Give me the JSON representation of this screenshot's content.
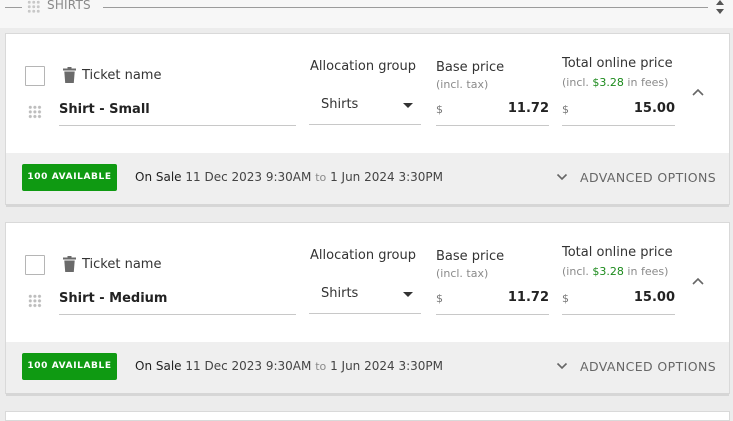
{
  "section": {
    "title": "SHIRTS"
  },
  "labels": {
    "ticket_name": "Ticket name",
    "allocation_group": "Allocation group",
    "base_price": "Base price",
    "incl_tax": "(incl. tax)",
    "total_online_price": "Total online price",
    "incl_prefix": "(incl.",
    "in_fees_suffix": "in fees)",
    "currency_symbol": "$",
    "on_sale": "On Sale",
    "to": "to",
    "advanced_options": "ADVANCED OPTIONS"
  },
  "tickets": [
    {
      "name": "Shirt - Small",
      "allocation_group": "Shirts",
      "base_price": "11.72",
      "fees": "$3.28",
      "total_price": "15.00",
      "availability": "100 AVAILABLE",
      "sale_start": "11 Dec 2023 9:30AM",
      "sale_end": "1 Jun 2024 3:30PM"
    },
    {
      "name": "Shirt - Medium",
      "allocation_group": "Shirts",
      "base_price": "11.72",
      "fees": "$3.28",
      "total_price": "15.00",
      "availability": "100 AVAILABLE",
      "sale_start": "11 Dec 2023 9:30AM",
      "sale_end": "1 Jun 2024 3:30PM"
    }
  ],
  "colors": {
    "available_badge": "#0f9a12",
    "fee_text": "#1c8a1c",
    "footer_bg": "#efefef",
    "page_bg": "#ececec"
  },
  "icons": [
    "grip-icon",
    "sort-arrows-icon",
    "trash-icon",
    "chevron-up-icon",
    "chevron-down-icon",
    "dropdown-caret-icon"
  ]
}
